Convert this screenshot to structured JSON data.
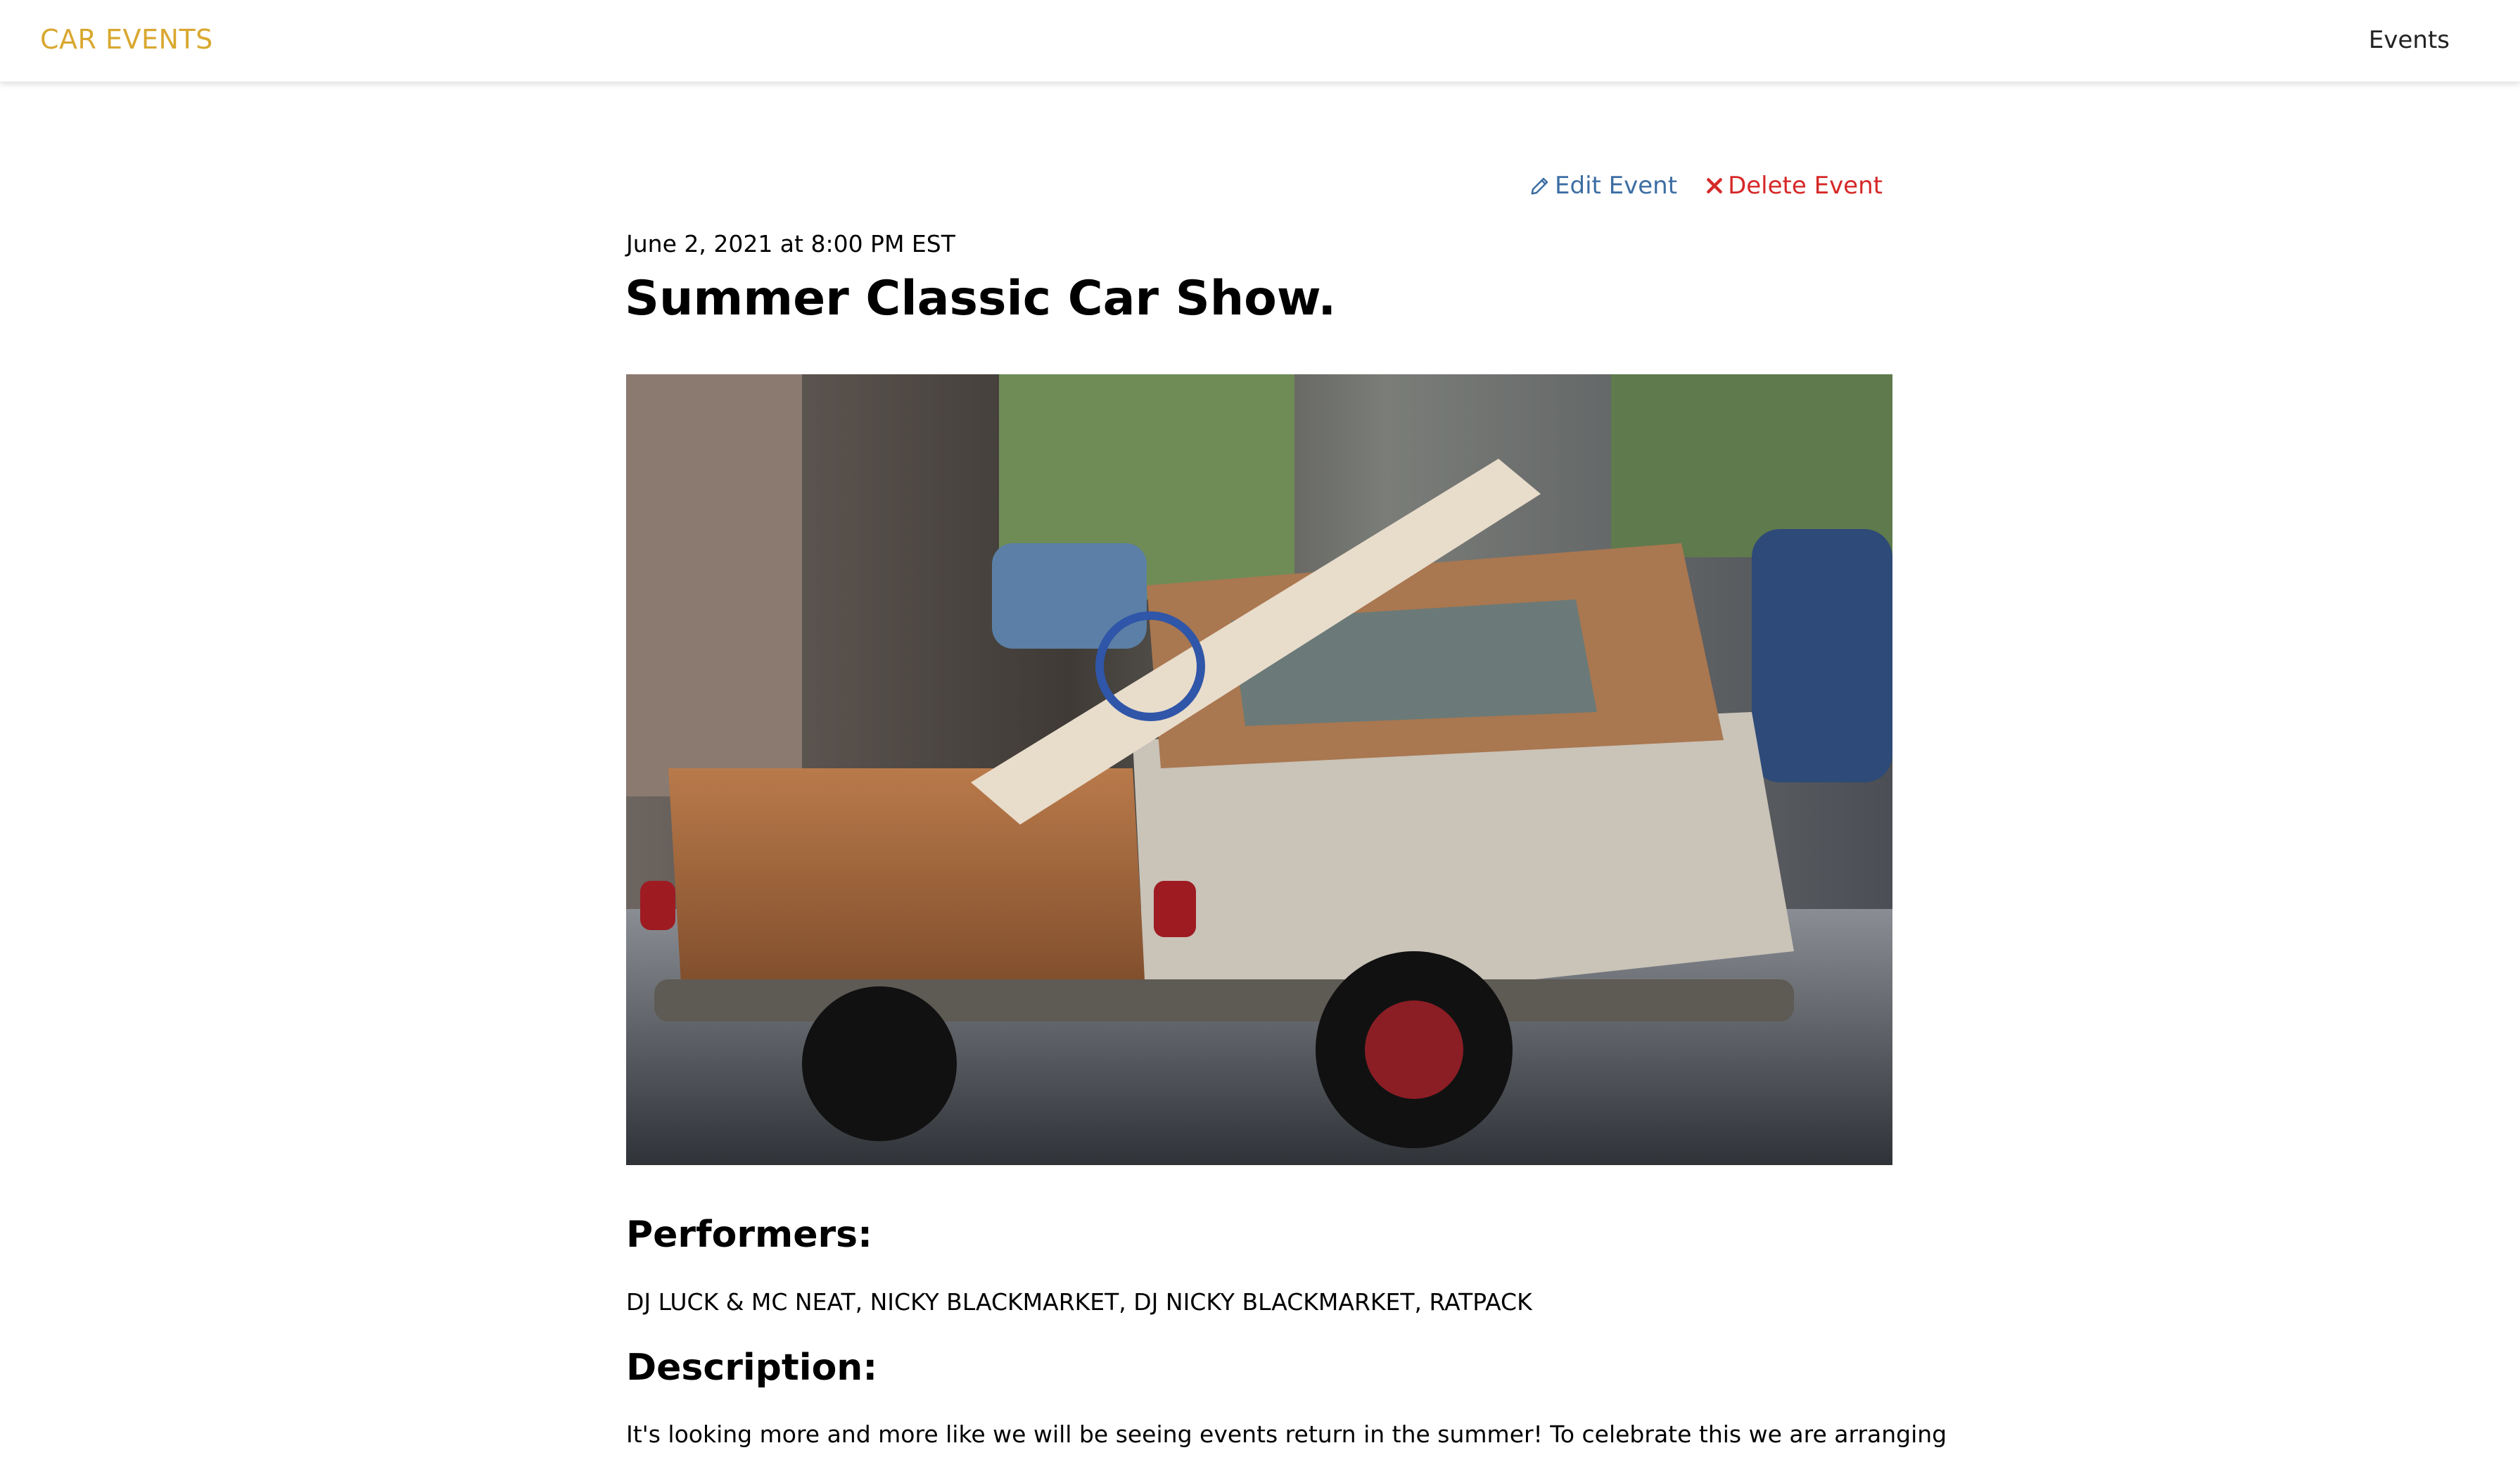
{
  "navbar": {
    "brand": "CAR EVENTS",
    "events_link": "Events"
  },
  "actions": {
    "edit_icon": "pencil-icon",
    "edit_label": "Edit Event",
    "delete_icon": "close-icon",
    "delete_label": "Delete Event"
  },
  "event": {
    "date": "June 2, 2021 at 8:00 PM EST",
    "title": "Summer Classic Car Show.",
    "image_alt": "Rusty vintage Ford pickup truck with a surfboard in the bed",
    "performers_heading": "Performers:",
    "performers": "DJ LUCK & MC NEAT, NICKY BLACKMARKET, DJ NICKY BLACKMARKET, RATPACK",
    "description_heading": "Description:",
    "description": "It's looking more and more like we will be seeing events return in the summer! To celebrate this we are arranging"
  },
  "colors": {
    "brand": "#d9a830",
    "edit": "#3d6ea3",
    "delete": "#d62828"
  }
}
